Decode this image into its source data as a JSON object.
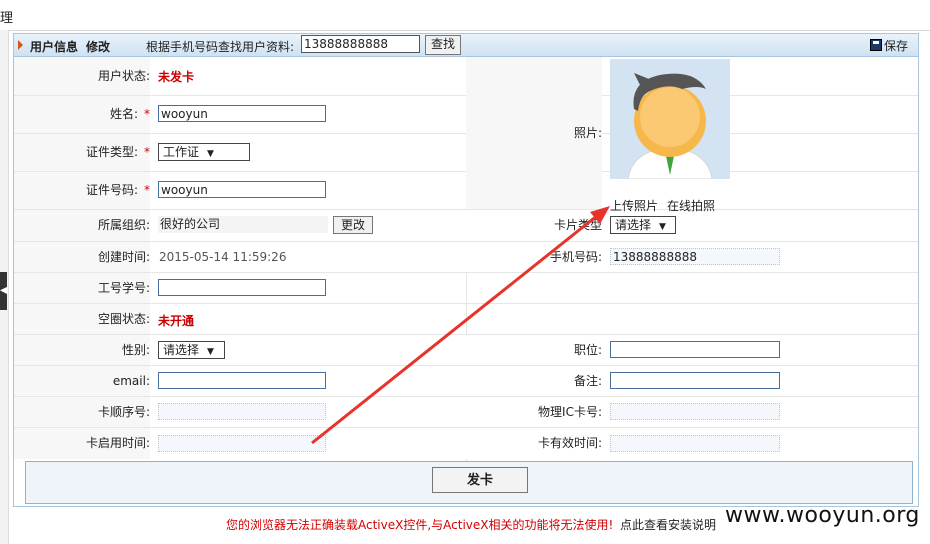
{
  "topbar": {
    "crumb": "理"
  },
  "header": {
    "title": "用户信息",
    "edit": "修改",
    "search_label": "根据手机号码查找用户资料:",
    "search_value": "13888888888",
    "find_button": "查找",
    "save_label": "保存"
  },
  "left": {
    "user_status": {
      "label": "用户状态:",
      "value": "未发卡"
    },
    "name": {
      "label": "姓名:",
      "required": "*",
      "value": "wooyun"
    },
    "id_type": {
      "label": "证件类型:",
      "required": "*",
      "value": "工作证"
    },
    "id_number": {
      "label": "证件号码:",
      "required": "*",
      "value": "wooyun"
    },
    "org": {
      "label": "所属组织:",
      "value": "很好的公司",
      "change_button": "更改"
    },
    "created": {
      "label": "创建时间:",
      "value": "2015-05-14 11:59:26"
    },
    "employee_no": {
      "label": "工号学号:",
      "value": ""
    },
    "air_status": {
      "label": "空圈状态:",
      "value": "未开通"
    },
    "gender": {
      "label": "性别:",
      "value": "请选择"
    },
    "email": {
      "label": "email:",
      "value": ""
    },
    "card_seq": {
      "label": "卡顺序号:",
      "value": ""
    },
    "card_start": {
      "label": "卡启用时间:",
      "value": ""
    }
  },
  "right": {
    "photo": {
      "label": "照片:",
      "upload_link": "上传照片",
      "capture_link": "在线拍照"
    },
    "card_type": {
      "label": "卡片类型",
      "value": "请选择"
    },
    "phone": {
      "label": "手机号码:",
      "value": "13888888888"
    },
    "position": {
      "label": "职位:",
      "value": ""
    },
    "remark": {
      "label": "备注:",
      "value": ""
    },
    "ic_card": {
      "label": "物理IC卡号:",
      "value": ""
    },
    "card_expiry": {
      "label": "卡有效时间:",
      "value": ""
    }
  },
  "footer": {
    "issue_button": "发卡",
    "activex_warning": "您的浏览器无法正确装载ActiveX控件,与ActiveX相关的功能将无法使用!",
    "install_help": "点此查看安装说明",
    "watermark": "www.wooyun.org"
  },
  "colors": {
    "required": "#d40000",
    "status_red": "#cc0000",
    "annotation_arrow": "#e8332a",
    "panel_border": "#a9c4dd"
  }
}
